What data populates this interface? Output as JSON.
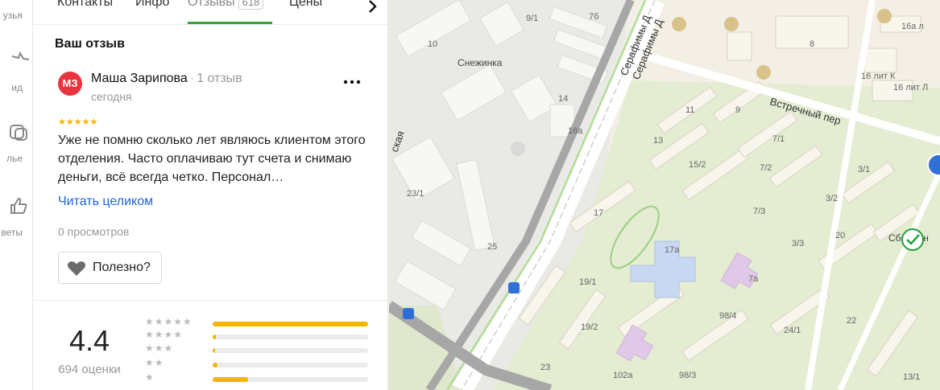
{
  "rail": {
    "items": [
      {
        "label": "узья",
        "icon": "friends-icon"
      },
      {
        "label": "ид",
        "icon": "star-icon"
      },
      {
        "label": "лье",
        "icon": "gallery-icon"
      },
      {
        "label": "веты",
        "icon": "thumbs-up-icon"
      }
    ]
  },
  "tabs": {
    "contacts": "Контакты",
    "info": "Инфо",
    "reviews": "Отзывы",
    "reviews_count": "618",
    "prices": "Цены",
    "next_icon": "chevron-right-icon"
  },
  "review": {
    "section_title": "Ваш отзыв",
    "avatar_initials": "МЗ",
    "avatar_color": "#e8343c",
    "author": "Маша Зарипова",
    "author_reviews": "1 отзыв",
    "separator": "·",
    "date": "сегодня",
    "stars": "★★★★★",
    "star_count": 5,
    "text": "Уже не помню сколько лет являюсь клиентом этого отделения. Часто оплачиваю тут счета и снимаю деньги, всё всегда четко. Персонал…",
    "read_more": "Читать целиком",
    "views": "0 просмотров",
    "useful_label": "Полезно?",
    "useful_icon": "heart-icon",
    "menu_icon": "more-dots-icon"
  },
  "rating": {
    "value": "4.4",
    "count_label": "694 оценки",
    "distribution": [
      {
        "stars": 5,
        "glyphs": "★★★★★",
        "fraction": 1.0
      },
      {
        "stars": 4,
        "glyphs": "★★★★",
        "fraction": 0.02
      },
      {
        "stars": 3,
        "glyphs": "★★★",
        "fraction": 0.01
      },
      {
        "stars": 2,
        "glyphs": "★★",
        "fraction": 0.03
      },
      {
        "stars": 1,
        "glyphs": "★",
        "fraction": 0.23
      }
    ],
    "bar_color": "#f5b400"
  },
  "map": {
    "streets": [
      "Серафимы Д",
      "Серафимы Д",
      "Встречный пер",
      "ская"
    ],
    "poi": [
      "Снежинка",
      "СберБан"
    ],
    "house_numbers": [
      "9/1",
      "7б",
      "10",
      "14",
      "16а",
      "23/1",
      "25",
      "11",
      "9",
      "13",
      "15/2",
      "7/1",
      "7/2",
      "17",
      "17а",
      "7/3",
      "7а",
      "19/1",
      "19/2",
      "98/4",
      "24/1",
      "23",
      "102а",
      "98/3",
      "8",
      "16а л",
      "16 лит К",
      "16 лит Л",
      "3/1",
      "3/2",
      "3/3",
      "20",
      "22",
      "13/1"
    ],
    "colors": {
      "background": "#f3efe4",
      "green": "#e1ebcf",
      "building": "#f6f3ea",
      "road": "#ffffff",
      "rail": "#b0d79a",
      "purple": "#e0c9e8",
      "blue": "#c9d8f2"
    }
  }
}
